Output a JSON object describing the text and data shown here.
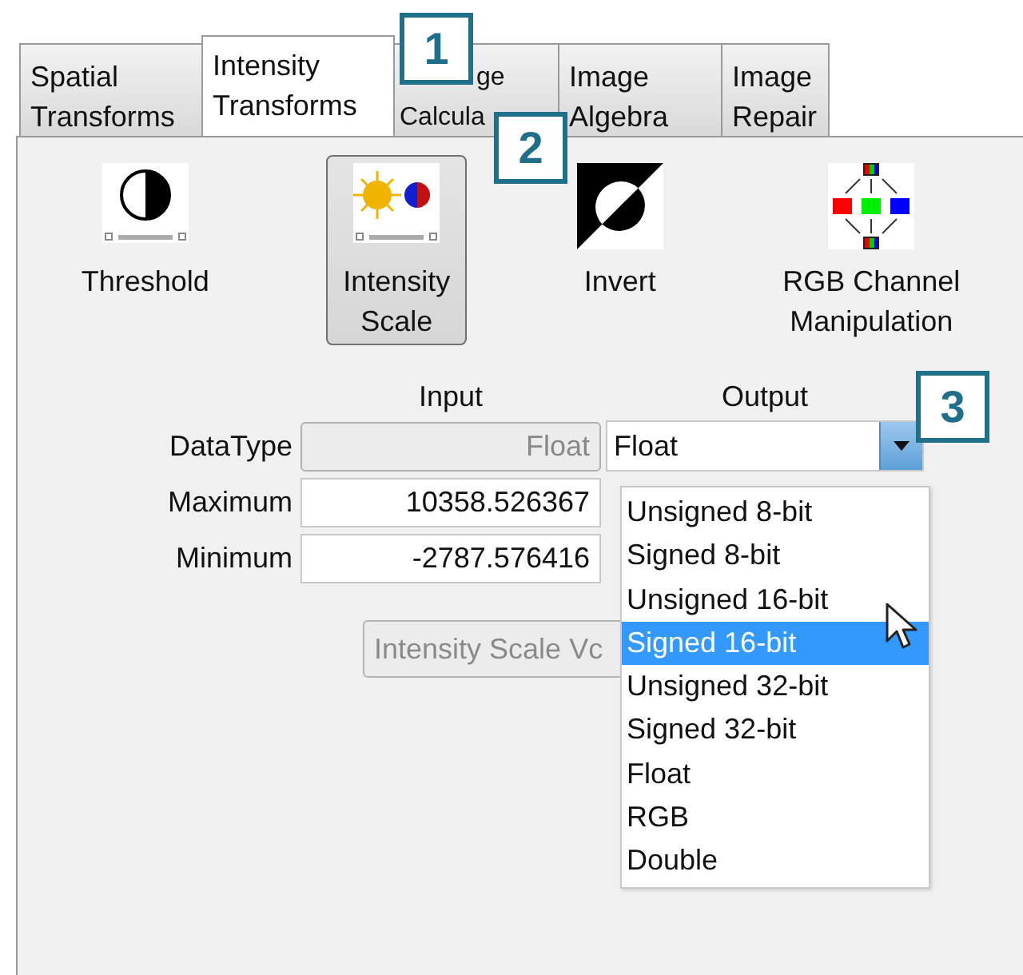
{
  "tabs": [
    {
      "lines": [
        "Spatial",
        "Transforms"
      ],
      "selected": false,
      "kind": "plain"
    },
    {
      "lines": [
        "Intensity",
        "Transforms"
      ],
      "selected": true,
      "kind": "plain"
    },
    {
      "lines": [
        "ge",
        "Calcula"
      ],
      "selected": false,
      "kind": "partly-hidden"
    },
    {
      "lines": [
        "Image",
        "Algebra"
      ],
      "selected": false,
      "kind": "plain"
    },
    {
      "lines": [
        "Image",
        "Repair"
      ],
      "selected": false,
      "kind": "plain"
    }
  ],
  "tools": [
    {
      "label": "Threshold",
      "kind": "threshold",
      "selected": false
    },
    {
      "label": "Intensity Scale",
      "kind": "intensity",
      "selected": true
    },
    {
      "label": "Invert",
      "kind": "invert",
      "selected": false
    },
    {
      "label": "RGB Channel Manipulation",
      "kind": "rgb",
      "selected": false
    }
  ],
  "form": {
    "columns": [
      "Input",
      "Output"
    ],
    "rows": [
      {
        "label": "DataType",
        "input": "Float",
        "input_disabled": true,
        "output": "Float"
      },
      {
        "label": "Maximum",
        "input": "10358.526367",
        "input_disabled": false
      },
      {
        "label": "Minimum",
        "input": "-2787.576416",
        "input_disabled": false
      }
    ],
    "button": {
      "label": "Intensity Scale Vc",
      "disabled": true
    },
    "options": [
      {
        "label": "Unsigned 8-bit",
        "selected": false
      },
      {
        "label": "Signed 8-bit",
        "selected": false
      },
      {
        "label": "Unsigned 16-bit",
        "selected": false
      },
      {
        "label": "Signed 16-bit",
        "selected": true
      },
      {
        "label": "Unsigned 32-bit",
        "selected": false
      },
      {
        "label": "Signed 32-bit",
        "selected": false
      },
      {
        "label": "Float",
        "selected": false
      },
      {
        "label": "RGB",
        "selected": false
      },
      {
        "label": "Double",
        "selected": false
      }
    ]
  },
  "callouts": [
    "1",
    "2",
    "3"
  ]
}
